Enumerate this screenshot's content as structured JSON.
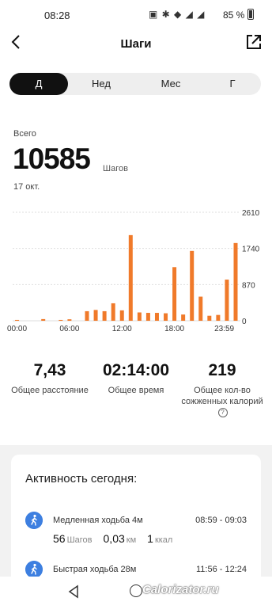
{
  "status_bar": {
    "time": "08:28",
    "battery": "85 %"
  },
  "header": {
    "title": "Шаги"
  },
  "tabs": [
    {
      "label": "Д",
      "active": true
    },
    {
      "label": "Нед",
      "active": false
    },
    {
      "label": "Мес",
      "active": false
    },
    {
      "label": "Г",
      "active": false
    }
  ],
  "summary": {
    "total_label": "Всего",
    "total_steps": "10585",
    "unit": "Шагов",
    "date": "17 окт."
  },
  "chart_data": {
    "type": "bar",
    "x_tick_labels": [
      "00:00",
      "06:00",
      "12:00",
      "18:00",
      "23:59"
    ],
    "y_tick_labels": [
      "2610",
      "1740",
      "870",
      "0"
    ],
    "ylim": [
      0,
      2610
    ],
    "bar_color": "#f07a2a",
    "bars": [
      {
        "hour": 0,
        "steps": 20
      },
      {
        "hour": 3,
        "steps": 40
      },
      {
        "hour": 5,
        "steps": 20
      },
      {
        "hour": 6,
        "steps": 35
      },
      {
        "hour": 8,
        "steps": 230
      },
      {
        "hour": 9,
        "steps": 260
      },
      {
        "hour": 10,
        "steps": 230
      },
      {
        "hour": 11,
        "steps": 420
      },
      {
        "hour": 12,
        "steps": 250
      },
      {
        "hour": 13,
        "steps": 2060
      },
      {
        "hour": 14,
        "steps": 200
      },
      {
        "hour": 15,
        "steps": 190
      },
      {
        "hour": 16,
        "steps": 190
      },
      {
        "hour": 17,
        "steps": 180
      },
      {
        "hour": 18,
        "steps": 1290
      },
      {
        "hour": 19,
        "steps": 150
      },
      {
        "hour": 20,
        "steps": 1680
      },
      {
        "hour": 21,
        "steps": 580
      },
      {
        "hour": 22,
        "steps": 120
      },
      {
        "hour": 23,
        "steps": 140
      },
      {
        "hour": 24,
        "steps": 990
      },
      {
        "hour": 25,
        "steps": 1870
      }
    ]
  },
  "stats": [
    {
      "value": "7,43",
      "label": "Общее расстояние"
    },
    {
      "value": "02:14:00",
      "label": "Общее время"
    },
    {
      "value": "219",
      "label": "Общее кол-во сожженных калорий"
    }
  ],
  "activity": {
    "title": "Активность сегодня:",
    "items": [
      {
        "name": "Медленная ходьба 4м",
        "time": "08:59 - 09:03",
        "steps": "56",
        "steps_unit": "Шагов",
        "distance": "0,03",
        "distance_unit": "км",
        "calories": "1",
        "calories_unit": "ккал"
      },
      {
        "name": "Быстрая ходьба 28м",
        "time": "11:56 - 12:24"
      }
    ]
  },
  "watermark": "Calorizator.ru",
  "icons": {
    "back": "chevron-left-icon",
    "export": "external-link-icon",
    "activity": "walking-person-icon"
  }
}
